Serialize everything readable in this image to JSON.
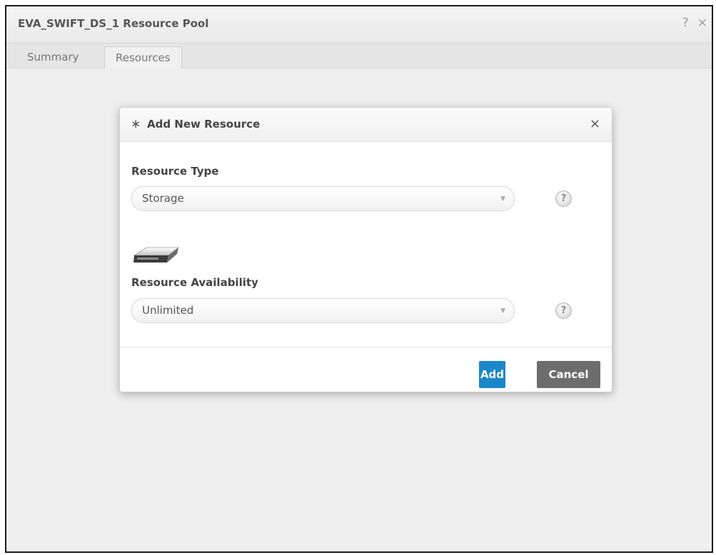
{
  "window": {
    "title": "EVA_SWIFT_DS_1 Resource Pool",
    "help_glyph": "?",
    "close_glyph": "×"
  },
  "tabs": [
    {
      "label": "Summary",
      "active": false
    },
    {
      "label": "Resources",
      "active": true
    }
  ],
  "modal": {
    "title_icon": "∗",
    "title": "Add New Resource",
    "close_glyph": "×",
    "fields": [
      {
        "label": "Resource Type",
        "value": "Storage",
        "help_glyph": "?"
      },
      {
        "label": "Resource Availability",
        "value": "Unlimited",
        "help_glyph": "?"
      }
    ],
    "type_icon": "storage-drive-icon",
    "add_label": "Add",
    "cancel_label": "Cancel"
  },
  "colors": {
    "primary_button": "#1b87c9",
    "secondary_button": "#6d6d6d",
    "window_background": "#efefef"
  }
}
